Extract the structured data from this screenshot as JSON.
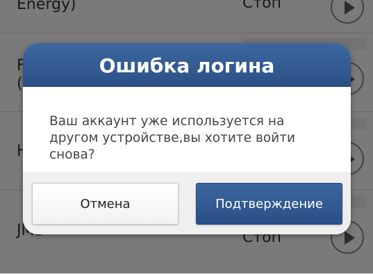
{
  "background_list": {
    "rows": [
      {
        "name": "Energy)",
        "status": "Стоп"
      },
      {
        "name": "F\n(",
        "status": ""
      },
      {
        "name": "H",
        "status": ""
      },
      {
        "name": "JMS",
        "status": "Стоп"
      }
    ]
  },
  "dialog": {
    "title": "Ошибка логина",
    "message": "Ваш аккаунт уже используется на другом устройстве,вы хотите войти снова?",
    "cancel_label": "Отмена",
    "confirm_label": "Подтверждение"
  }
}
